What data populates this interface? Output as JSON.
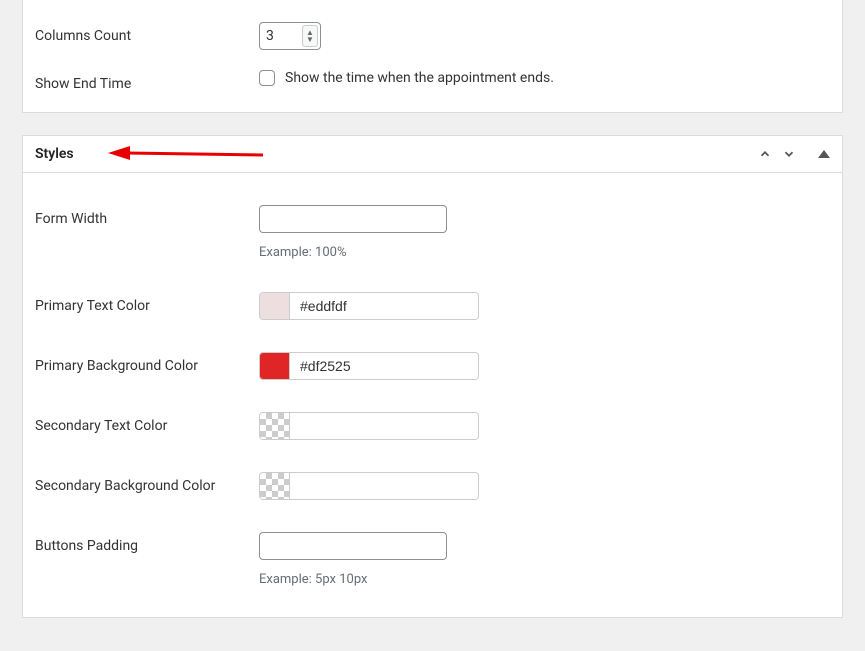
{
  "topSection": {
    "columnsCount": {
      "label": "Columns Count",
      "value": "3"
    },
    "showEndTime": {
      "label": "Show End Time",
      "checkboxLabel": "Show the time when the appointment ends."
    }
  },
  "stylesSection": {
    "title": "Styles",
    "formWidth": {
      "label": "Form Width",
      "value": "",
      "hint": "Example: 100%"
    },
    "primaryTextColor": {
      "label": "Primary Text Color",
      "value": "#eddfdf",
      "swatch": "#eddfdf"
    },
    "primaryBgColor": {
      "label": "Primary Background Color",
      "value": "#df2525",
      "swatch": "#df2525"
    },
    "secondaryTextColor": {
      "label": "Secondary Text Color",
      "value": "",
      "swatch": "checker"
    },
    "secondaryBgColor": {
      "label": "Secondary Background Color",
      "value": "",
      "swatch": "checker"
    },
    "buttonsPadding": {
      "label": "Buttons Padding",
      "value": "",
      "hint": "Example: 5px 10px"
    }
  }
}
